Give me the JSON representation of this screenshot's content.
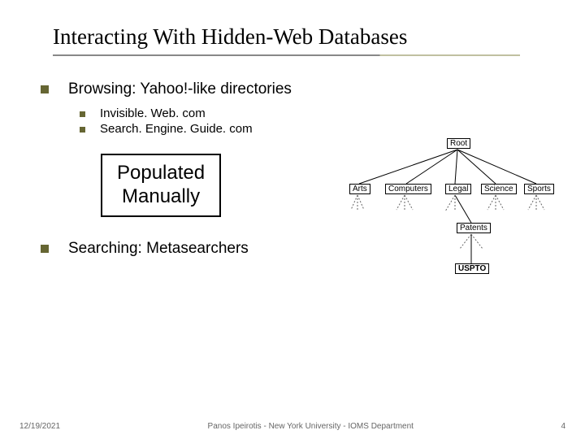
{
  "title": "Interacting With Hidden-Web Databases",
  "bullets": {
    "browsing": {
      "label": "Browsing: Yahoo!-like directories",
      "sub": [
        "Invisible. Web. com",
        "Search. Engine. Guide. com"
      ]
    },
    "box": {
      "line1": "Populated",
      "line2": "Manually"
    },
    "searching": {
      "label": "Searching: Metasearchers"
    }
  },
  "tree": {
    "root": "Root",
    "level1": [
      "Arts",
      "Computers",
      "Legal",
      "Science",
      "Sports"
    ],
    "level2": "Patents",
    "leaf": "USPTO"
  },
  "footer": {
    "date": "12/19/2021",
    "center": "Panos Ipeirotis - New York University - IOMS Department",
    "page": "4"
  }
}
